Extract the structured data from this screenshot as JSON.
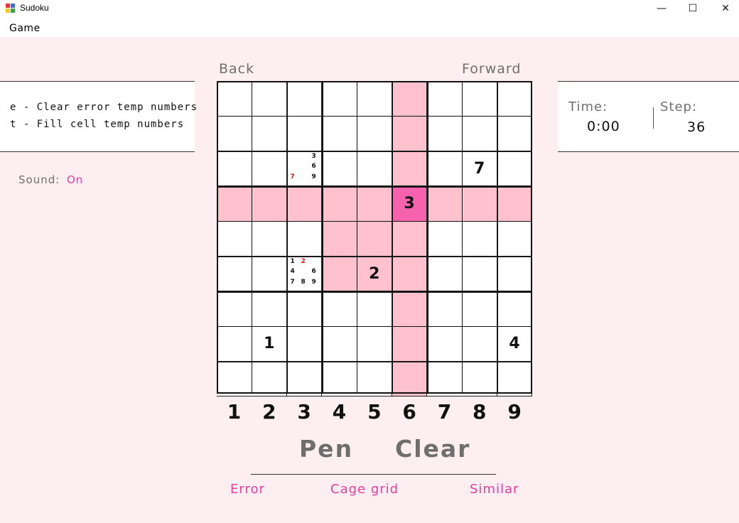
{
  "window": {
    "title": "Sudoku",
    "minimize_glyph": "—",
    "maximize_glyph": "☐",
    "close_glyph": "✕",
    "app_icon": "sudoku-app-icon"
  },
  "menu": {
    "game": "Game"
  },
  "nav": {
    "back": "Back",
    "forward": "Forward"
  },
  "hints": [
    "e - Clear error temp numbers",
    "t - Fill cell temp numbers"
  ],
  "sound": {
    "label": "Sound:",
    "value": "On"
  },
  "stats": {
    "time_label": "Time:",
    "time_value": "0:00",
    "step_label": "Step:",
    "step_value": "36"
  },
  "board": {
    "selected": {
      "row": 4,
      "col": 6
    },
    "values": [
      [
        "",
        "",
        "",
        "",
        "",
        "",
        "",
        "",
        ""
      ],
      [
        "",
        "",
        "",
        "",
        "",
        "",
        "",
        "",
        ""
      ],
      [
        "",
        "",
        "",
        "",
        "",
        "",
        "",
        "7",
        ""
      ],
      [
        "",
        "",
        "",
        "",
        "",
        "3",
        "",
        "",
        ""
      ],
      [
        "",
        "",
        "",
        "",
        "",
        "",
        "",
        "",
        ""
      ],
      [
        "",
        "",
        "",
        "",
        "2",
        "",
        "",
        "",
        ""
      ],
      [
        "",
        "",
        "",
        "",
        "",
        "",
        "",
        "",
        ""
      ],
      [
        "",
        "1",
        "",
        "",
        "",
        "",
        "",
        "",
        "4"
      ],
      [
        "",
        "",
        "",
        "",
        "",
        "",
        "",
        "",
        ""
      ]
    ],
    "pencil_marks": [
      {
        "row": 3,
        "col": 3,
        "marks": [
          {
            "digit": "3",
            "error": false
          },
          {
            "digit": "6",
            "error": false
          },
          {
            "digit": "7",
            "error": true
          },
          {
            "digit": "9",
            "error": false
          }
        ]
      },
      {
        "row": 6,
        "col": 3,
        "marks": [
          {
            "digit": "1",
            "error": false
          },
          {
            "digit": "2",
            "error": true
          },
          {
            "digit": "4",
            "error": false
          },
          {
            "digit": "6",
            "error": false
          },
          {
            "digit": "7",
            "error": false
          },
          {
            "digit": "8",
            "error": false
          },
          {
            "digit": "9",
            "error": false
          }
        ]
      }
    ]
  },
  "digits": [
    "1",
    "2",
    "3",
    "4",
    "5",
    "6",
    "7",
    "8",
    "9"
  ],
  "modes": {
    "pen": "Pen",
    "clear": "Clear"
  },
  "options": {
    "error": "Error",
    "cage_grid": "Cage grid",
    "similar": "Similar"
  },
  "colors": {
    "background": "#fdeef2",
    "highlight": "#ffc1ce",
    "selected": "#f762ae",
    "accent": "#e8409a",
    "error_mark": "#e0101a"
  }
}
